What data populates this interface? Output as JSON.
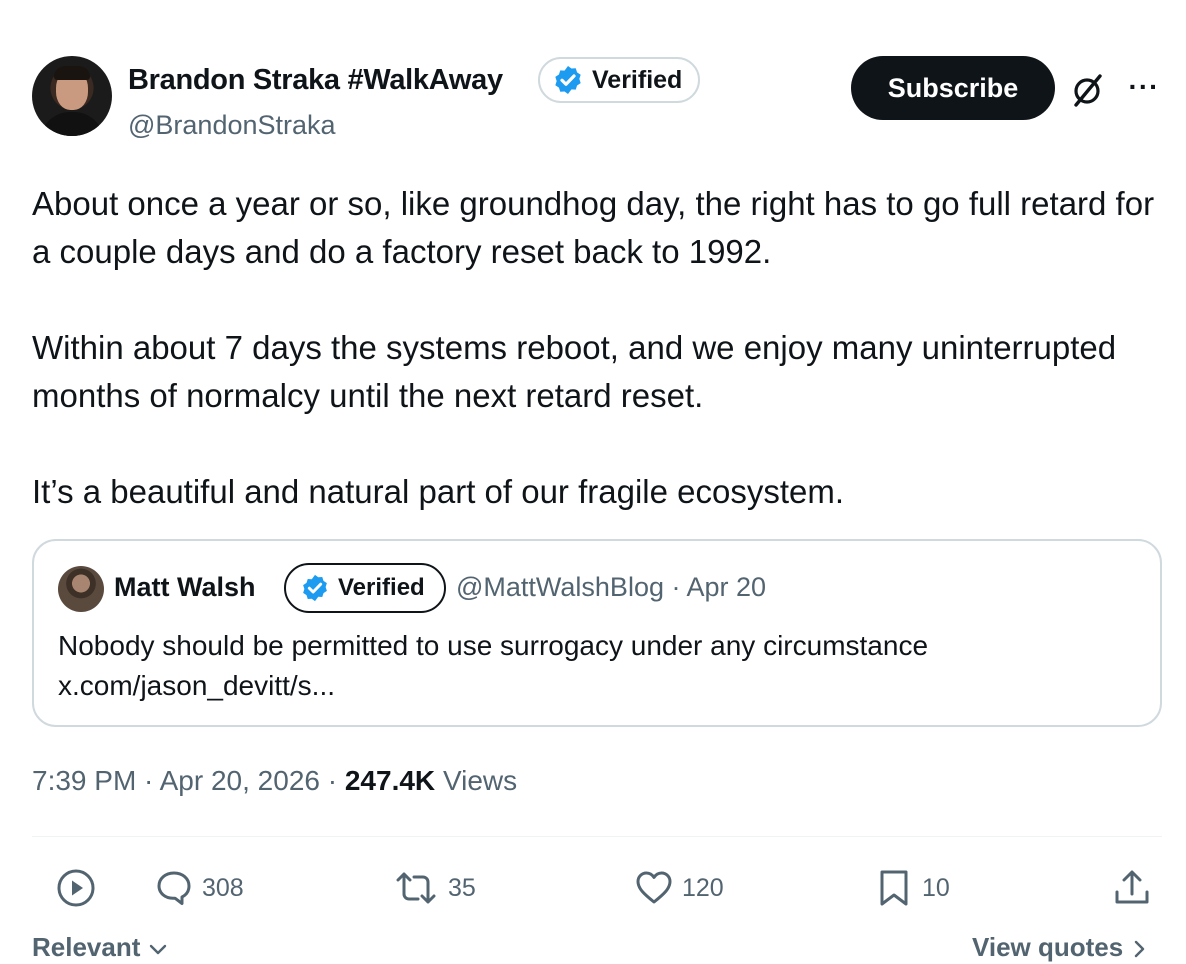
{
  "author": {
    "name": "Brandon Straka #WalkAway",
    "handle": "@BrandonStraka",
    "verified_label": "Verified"
  },
  "header": {
    "subscribe_label": "Subscribe",
    "grok_icon": "grok-icon",
    "more_label": "···"
  },
  "tweet": {
    "paragraphs": [
      "About once a year or so, like groundhog day, the right has to go full retard for a couple days and do a factory reset back to 1992.",
      "Within about 7 days the systems reboot, and we enjoy many uninterrupted months of normalcy until the next retard reset.",
      "It’s a beautiful and natural part of our fragile ecosystem."
    ]
  },
  "quote": {
    "name": "Matt Walsh",
    "verified_label": "Verified",
    "handle_date": "@MattWalshBlog · Apr 20",
    "text": "Nobody should be permitted to use surrogacy under any circumstance",
    "link": "x.com/jason_devitt/s..."
  },
  "meta": {
    "time": "7:39 PM",
    "sep": " · ",
    "date": "Apr 20, 2026",
    "views_count": "247.4K",
    "views_label": "Views"
  },
  "actions": {
    "replies": "308",
    "reposts": "35",
    "likes": "120",
    "bookmarks": "10"
  },
  "footer": {
    "relevant_label": "Relevant",
    "view_quotes_label": "View quotes"
  },
  "colors": {
    "verified_blue": "#1d9bf0",
    "text_primary": "#0f1419",
    "text_secondary": "#536471",
    "border": "#cfd9de"
  }
}
